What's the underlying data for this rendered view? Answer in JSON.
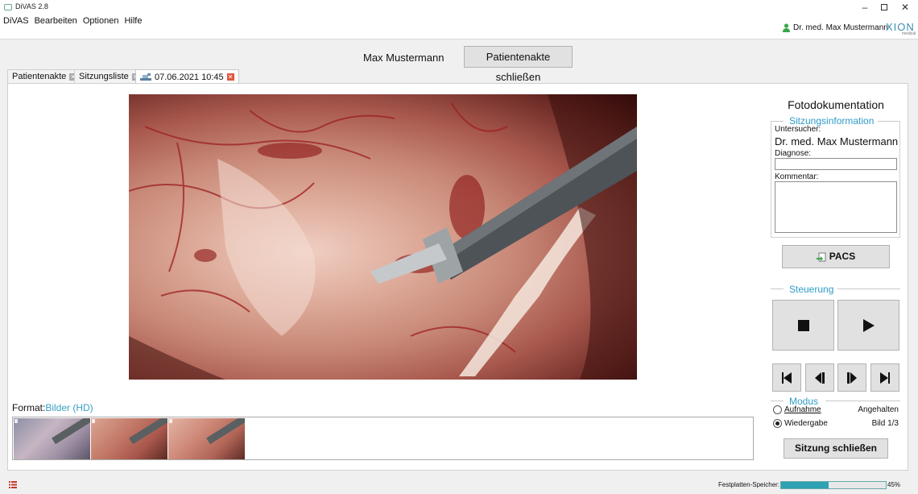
{
  "window": {
    "title": "DiVAS 2.8",
    "minimize": "–",
    "close": "✕"
  },
  "menu": [
    "DiVAS",
    "Bearbeiten",
    "Optionen",
    "Hilfe"
  ],
  "header": {
    "user_name": "Dr. med. Max Mustermann",
    "logo_text": "XION",
    "logo_sub": "medical"
  },
  "patient": {
    "name": "Max Mustermann",
    "close_record_label": "Patientenakte schließen"
  },
  "tabs": [
    {
      "label": "Patientenakte",
      "active": false
    },
    {
      "label": "Sitzungsliste",
      "active": false
    },
    {
      "label": "07.06.2021 10:45",
      "active": true
    }
  ],
  "format": {
    "label": "Format:",
    "value": "Bilder (HD)"
  },
  "thumbnails": [
    "thumbnail-1",
    "thumbnail-2",
    "thumbnail-3"
  ],
  "right_panel": {
    "title": "Fotodokumentation",
    "session_info": {
      "heading": "Sitzungsinformation",
      "examiner_label": "Untersucher:",
      "examiner_value": "Dr. med. Max Mustermann",
      "diagnosis_label": "Diagnose:",
      "diagnosis_value": "",
      "comment_label": "Kommentar:",
      "comment_value": ""
    },
    "pacs_label": "PACS",
    "control_heading": "Steuerung",
    "mode": {
      "heading": "Modus",
      "record_label": "Aufnahme",
      "playback_label": "Wiedergabe",
      "selected": "Wiedergabe",
      "state_text": "Angehalten",
      "image_counter": "Bild 1/3"
    },
    "end_session_label": "Sitzung schließen"
  },
  "status_bar": {
    "storage_label": "Festplatten-Speicher:",
    "storage_percent": 45,
    "storage_percent_text": "45%"
  },
  "colors": {
    "accent": "#2e9cc7",
    "progress": "#2ea1b3",
    "tab_close_active": "#e0553c"
  },
  "icons": [
    "app-icon",
    "user-icon",
    "tab-close-icon",
    "session-icon",
    "pacs-icon",
    "stop-icon",
    "play-icon",
    "skip-first-icon",
    "step-back-icon",
    "step-forward-icon",
    "skip-last-icon",
    "list-icon"
  ]
}
